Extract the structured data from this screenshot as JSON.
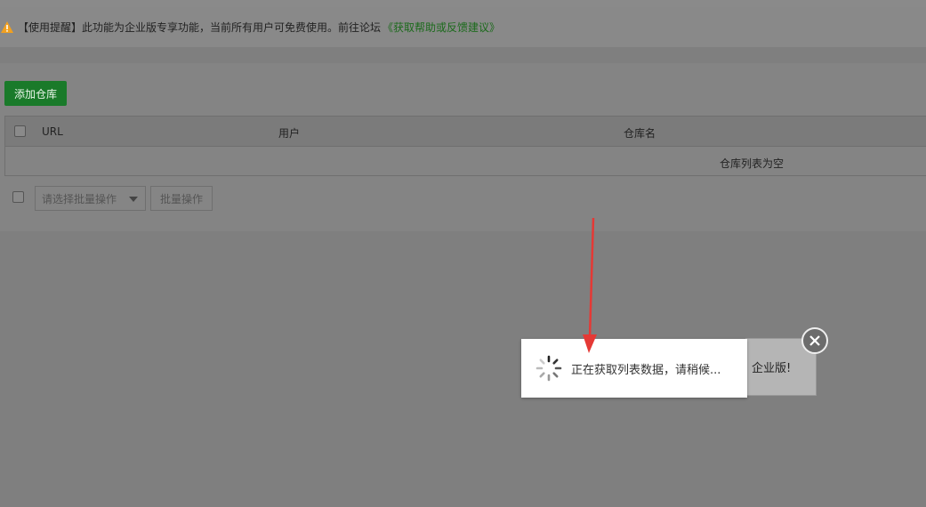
{
  "notice": {
    "text": "【使用提醒】此功能为企业版专享功能，当前所有用户可免费使用。前往论坛",
    "link": "《获取帮助或反馈建议》",
    "icon": "warning-icon"
  },
  "toolbar": {
    "add_label": "添加仓库"
  },
  "table": {
    "columns": [
      "URL",
      "用户",
      "仓库名"
    ],
    "empty_text": "仓库列表为空"
  },
  "footer": {
    "select_placeholder": "请选择批量操作",
    "batch_label": "批量操作"
  },
  "loading": {
    "message": "正在获取列表数据，请稍候..."
  },
  "background_dialog": {
    "fragment": "企业版!"
  },
  "colors": {
    "accent_green": "#1a7a2a",
    "link_green": "#1b6a1b",
    "arrow_red": "#e53935",
    "warning_orange": "#f0a020"
  }
}
